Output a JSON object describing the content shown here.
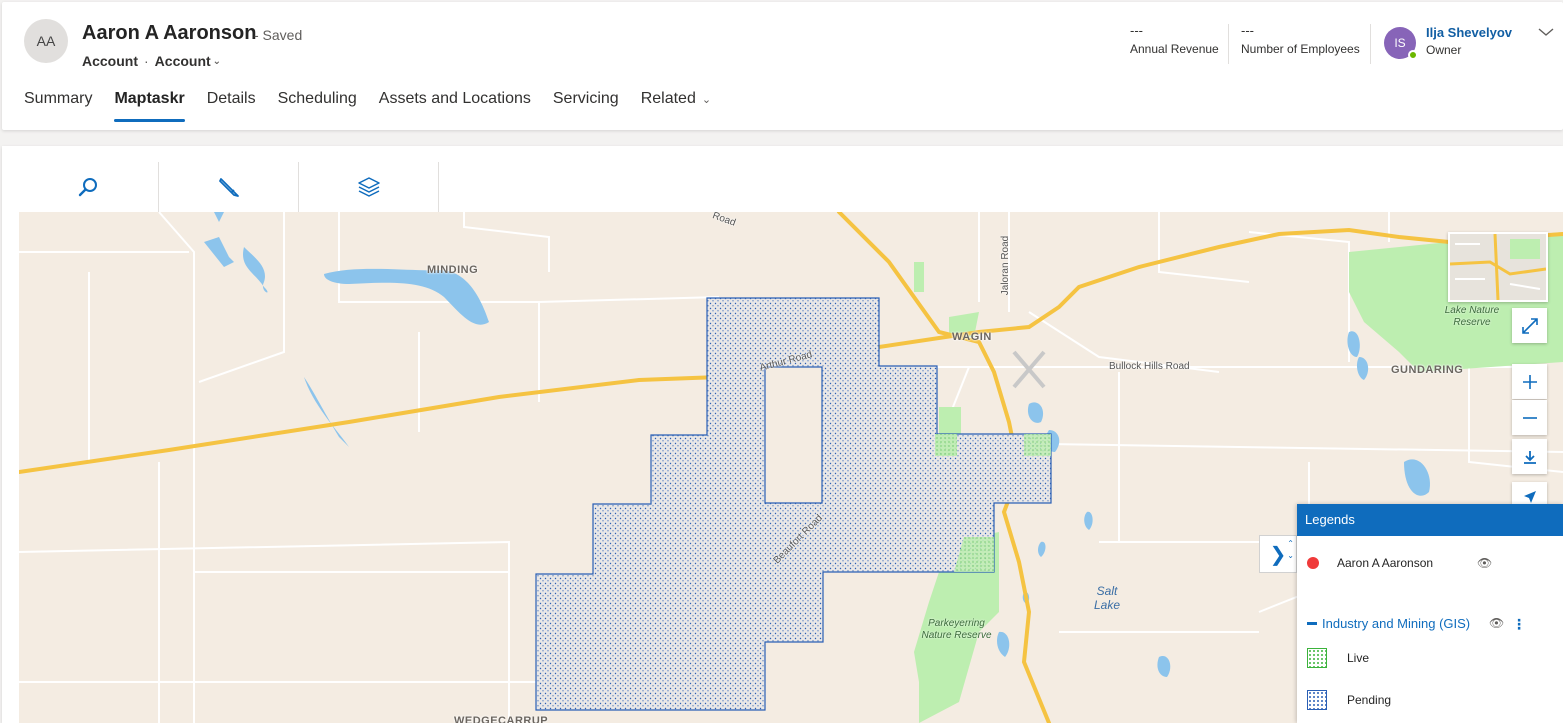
{
  "record": {
    "initials": "AA",
    "name": "Aaron A Aaronson",
    "saved_status": "- Saved",
    "entity": "Account",
    "separator": "·",
    "form": "Account"
  },
  "kpis": [
    {
      "value": "---",
      "label": "Annual Revenue"
    },
    {
      "value": "---",
      "label": "Number of Employees"
    }
  ],
  "owner": {
    "initials": "IS",
    "name": "Ilja Shevelyov",
    "role": "Owner"
  },
  "tabs": [
    {
      "label": "Summary"
    },
    {
      "label": "Maptaskr"
    },
    {
      "label": "Details"
    },
    {
      "label": "Scheduling"
    },
    {
      "label": "Assets and Locations"
    },
    {
      "label": "Servicing"
    },
    {
      "label": "Related"
    }
  ],
  "map": {
    "place_labels": {
      "minding": "MINDING",
      "wagin": "WAGIN",
      "gundaring": "GUNDARING",
      "wedgecarrup": "WEDGECARRUP"
    },
    "road_labels": {
      "arthur": "Arthur Road",
      "bullock": "Bullock Hills Road",
      "jaloran": "Jaloran Road",
      "beaufort": "Beaufort Road",
      "road_top": "Road"
    },
    "park_labels": {
      "lake_reserve": "Lake Nature Reserve",
      "parkeyerring": "Parkeyerring Nature Reserve"
    },
    "water_labels": {
      "salt_lake": "Salt Lake"
    }
  },
  "legend": {
    "title": "Legends",
    "record_entry": "Aaron A Aaronson",
    "group": "Industry and Mining (GIS)",
    "items": [
      {
        "label": "Live",
        "color": "#3bb33b"
      },
      {
        "label": "Pending",
        "color": "#2a5fb5"
      }
    ]
  },
  "colors": {
    "accent": "#0f6cbd",
    "map_land": "#f4ece2",
    "map_water": "#8cc4ec",
    "map_park": "#bdeeb0",
    "highway": "#f5c342",
    "pending_outline": "#2a5fb5",
    "live_outline": "#3bb33b"
  },
  "icons": {
    "search": "search-icon",
    "pencil": "pencil-icon",
    "layers": "layers-icon",
    "expand": "expand-icon",
    "zoom_in": "plus-icon",
    "zoom_out": "minus-icon",
    "download": "download-icon",
    "locate": "locate-icon",
    "eye": "eye-icon"
  }
}
